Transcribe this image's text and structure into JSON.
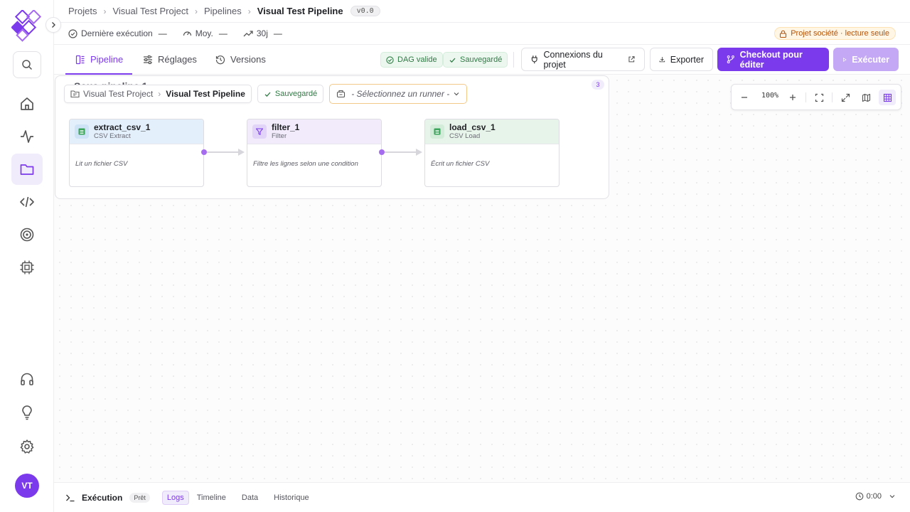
{
  "breadcrumb": {
    "items": [
      "Projets",
      "Visual Test Project",
      "Pipelines",
      "Visual Test Pipeline"
    ],
    "version": "v0.0"
  },
  "stats": {
    "last_run_label": "Dernière exécution",
    "last_run_value": "—",
    "avg_label": "Moy.",
    "avg_value": "—",
    "trend_label": "30j",
    "trend_value": "—"
  },
  "readonly_badge": "Projet société · lecture seule",
  "tabs": [
    {
      "label": "Pipeline",
      "icon": "pipeline-icon",
      "active": true
    },
    {
      "label": "Réglages",
      "icon": "sliders-icon",
      "active": false
    },
    {
      "label": "Versions",
      "icon": "history-icon",
      "active": false
    }
  ],
  "status_pills": {
    "dag": "DAG valide",
    "saved": "Sauvegardé"
  },
  "actions": {
    "connections": "Connexions du projet",
    "export": "Exporter",
    "checkout": "Checkout pour éditer",
    "run": "Exécuter"
  },
  "canvas": {
    "group_title": "Sous-pipeline 1",
    "group_count": "3",
    "pipeline_breadcrumb": [
      "Visual Test Project",
      "Visual Test Pipeline"
    ],
    "saved": "Sauvegardé",
    "runner_placeholder": "- Sélectionnez un runner -",
    "zoom": "100%",
    "nodes": [
      {
        "name": "extract_csv_1",
        "type": "CSV Extract",
        "description": "Lit un fichier CSV",
        "color": "#e3effb"
      },
      {
        "name": "filter_1",
        "type": "Filter",
        "description": "Filtre les lignes selon une condition",
        "color": "#f1ebfb"
      },
      {
        "name": "load_csv_1",
        "type": "CSV Load",
        "description": "Écrit un fichier CSV",
        "color": "#e7f4ea"
      }
    ]
  },
  "bottom_panel": {
    "title": "Exécution",
    "status": "Prêt",
    "tabs": [
      "Logs",
      "Timeline",
      "Data",
      "Historique"
    ],
    "active_tab": "Logs",
    "timer": "0:00"
  },
  "user": {
    "initials": "VT"
  },
  "colors": {
    "accent": "#7c3aed",
    "accent_soft": "#f1ecfb",
    "success": "#2f7a44",
    "warning": "#b45309"
  }
}
